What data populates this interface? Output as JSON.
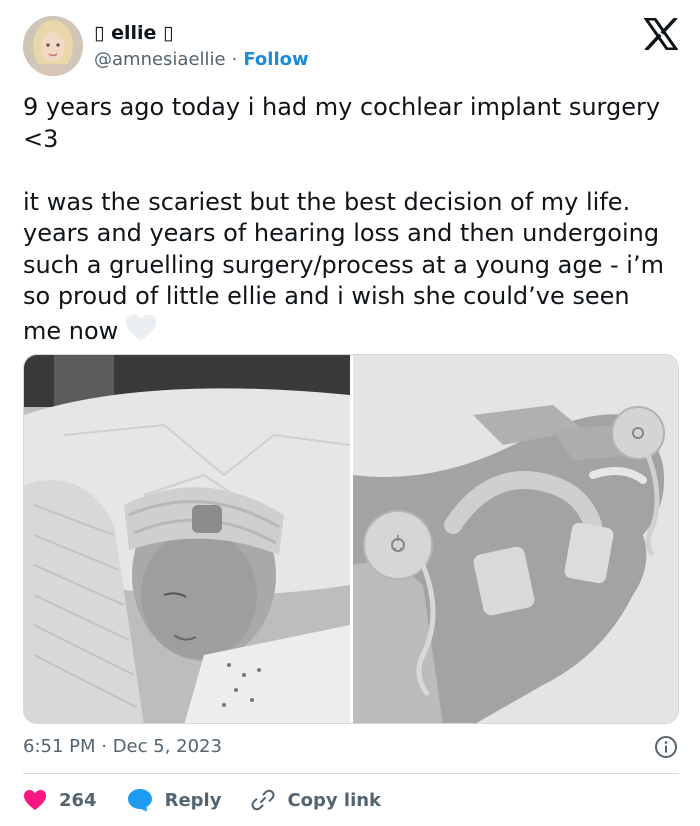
{
  "user": {
    "display_name": "▯ ellie ▯",
    "handle": "@amnesiaellie",
    "separator": "·",
    "follow_label": "Follow"
  },
  "tweet": {
    "text": "9 years ago today i had my cochlear implant surgery <3\n\nit was the scariest but the best decision of my life. years and years of hearing loss and then undergoing such a gruelling surgery/process at a young age - i’m so proud of little ellie and i wish she could’ve seen me now",
    "timestamp": "6:51 PM · Dec 5, 2023"
  },
  "actions": {
    "like_count": "264",
    "reply_label": "Reply",
    "copy_link_label": "Copy link"
  },
  "colors": {
    "text": "#0f1419",
    "secondary": "#536471",
    "link_blue": "#1d8cd8",
    "like_red": "#f91880",
    "reply_blue": "#1d9bf0",
    "border": "#cfd9de"
  },
  "icons": [
    "x-logo-icon",
    "info-icon",
    "heart-icon",
    "reply-bubble-icon",
    "link-icon",
    "white-heart-emoji-icon"
  ]
}
